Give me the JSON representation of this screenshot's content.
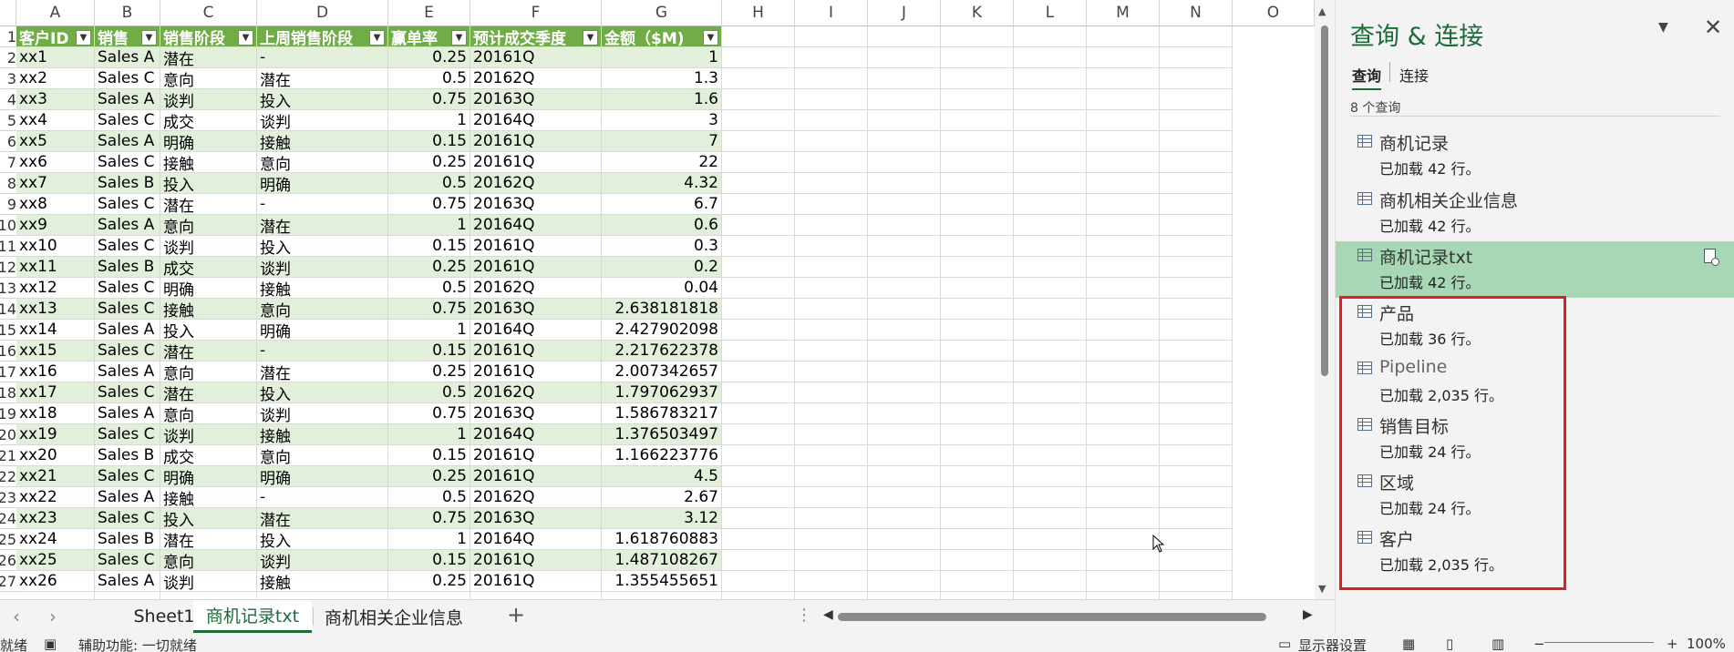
{
  "grid": {
    "column_letters": [
      "A",
      "B",
      "C",
      "D",
      "E",
      "F",
      "G",
      "H",
      "I",
      "J",
      "K",
      "L",
      "M",
      "N",
      "O"
    ],
    "headers": [
      "客户ID",
      "销售",
      "销售阶段",
      "上周销售阶段",
      "赢单率",
      "预计成交季度",
      "金额（$M)"
    ],
    "row_numbers": [
      "1",
      "2",
      "3",
      "4",
      "5",
      "6",
      "7",
      "8",
      "9",
      "10",
      "11",
      "12",
      "13",
      "14",
      "15",
      "16",
      "17",
      "18",
      "19",
      "20",
      "21",
      "22",
      "23",
      "24",
      "25",
      "26",
      "27"
    ],
    "rows": [
      [
        "xx1",
        "Sales A",
        "潜在",
        "-",
        "0.25",
        "20161Q",
        "1"
      ],
      [
        "xx2",
        "Sales C",
        "意向",
        "潜在",
        "0.5",
        "20162Q",
        "1.3"
      ],
      [
        "xx3",
        "Sales A",
        "谈判",
        "投入",
        "0.75",
        "20163Q",
        "1.6"
      ],
      [
        "xx4",
        "Sales C",
        "成交",
        "谈判",
        "1",
        "20164Q",
        "3"
      ],
      [
        "xx5",
        "Sales A",
        "明确",
        "接触",
        "0.15",
        "20161Q",
        "7"
      ],
      [
        "xx6",
        "Sales C",
        "接触",
        "意向",
        "0.25",
        "20161Q",
        "22"
      ],
      [
        "xx7",
        "Sales B",
        "投入",
        "明确",
        "0.5",
        "20162Q",
        "4.32"
      ],
      [
        "xx8",
        "Sales C",
        "潜在",
        "-",
        "0.75",
        "20163Q",
        "6.7"
      ],
      [
        "xx9",
        "Sales A",
        "意向",
        "潜在",
        "1",
        "20164Q",
        "0.6"
      ],
      [
        "xx10",
        "Sales C",
        "谈判",
        "投入",
        "0.15",
        "20161Q",
        "0.3"
      ],
      [
        "xx11",
        "Sales B",
        "成交",
        "谈判",
        "0.25",
        "20161Q",
        "0.2"
      ],
      [
        "xx12",
        "Sales C",
        "明确",
        "接触",
        "0.5",
        "20162Q",
        "0.04"
      ],
      [
        "xx13",
        "Sales C",
        "接触",
        "意向",
        "0.75",
        "20163Q",
        "2.638181818"
      ],
      [
        "xx14",
        "Sales A",
        "投入",
        "明确",
        "1",
        "20164Q",
        "2.427902098"
      ],
      [
        "xx15",
        "Sales C",
        "潜在",
        "-",
        "0.15",
        "20161Q",
        "2.217622378"
      ],
      [
        "xx16",
        "Sales A",
        "意向",
        "潜在",
        "0.25",
        "20161Q",
        "2.007342657"
      ],
      [
        "xx17",
        "Sales C",
        "潜在",
        "投入",
        "0.5",
        "20162Q",
        "1.797062937"
      ],
      [
        "xx18",
        "Sales A",
        "意向",
        "谈判",
        "0.75",
        "20163Q",
        "1.586783217"
      ],
      [
        "xx19",
        "Sales C",
        "谈判",
        "接触",
        "1",
        "20164Q",
        "1.376503497"
      ],
      [
        "xx20",
        "Sales B",
        "成交",
        "意向",
        "0.15",
        "20161Q",
        "1.166223776"
      ],
      [
        "xx21",
        "Sales C",
        "明确",
        "明确",
        "0.25",
        "20161Q",
        "4.5"
      ],
      [
        "xx22",
        "Sales A",
        "接触",
        "-",
        "0.5",
        "20162Q",
        "2.67"
      ],
      [
        "xx23",
        "Sales C",
        "投入",
        "潜在",
        "0.75",
        "20163Q",
        "3.12"
      ],
      [
        "xx24",
        "Sales B",
        "潜在",
        "投入",
        "1",
        "20164Q",
        "1.618760883"
      ],
      [
        "xx25",
        "Sales C",
        "意向",
        "谈判",
        "0.15",
        "20161Q",
        "1.487108267"
      ],
      [
        "xx26",
        "Sales A",
        "谈判",
        "接触",
        "0.25",
        "20161Q",
        "1.355455651"
      ]
    ],
    "header_fill": "#70ad47",
    "band_fill": "#e2efda"
  },
  "sheet_tabs": [
    {
      "label": "Sheet1",
      "active": false
    },
    {
      "label": "商机记录txt",
      "active": true
    },
    {
      "label": "商机相关企业信息",
      "active": false
    }
  ],
  "add_sheet": "+",
  "status": {
    "ready": "就绪",
    "accessibility": "辅助功能: 一切就绪",
    "display_settings": "显示器设置",
    "zoom": "100%"
  },
  "pane": {
    "title": "查询 & 连接",
    "tabs": [
      "查询",
      "连接"
    ],
    "count": "8 个查询",
    "queries": [
      {
        "name": "商机记录",
        "status": "已加载 42 行。",
        "selected": false
      },
      {
        "name": "商机相关企业信息",
        "status": "已加载 42 行。",
        "selected": false
      },
      {
        "name": "商机记录txt",
        "status": "已加载 42 行。",
        "selected": true
      },
      {
        "name": "产品",
        "status": "已加载 36 行。",
        "selected": false
      },
      {
        "name": "Pipeline",
        "status": "已加载 2,035 行。",
        "selected": false
      },
      {
        "name": "销售目标",
        "status": "已加载 24 行。",
        "selected": false
      },
      {
        "name": "区域",
        "status": "已加载 24 行。",
        "selected": false
      },
      {
        "name": "客户",
        "status": "已加载 2,035 行。",
        "selected": false
      }
    ],
    "accent": "#1e6b3a",
    "selected_fill": "#a7d7b5",
    "highlight_color": "#e02020"
  }
}
